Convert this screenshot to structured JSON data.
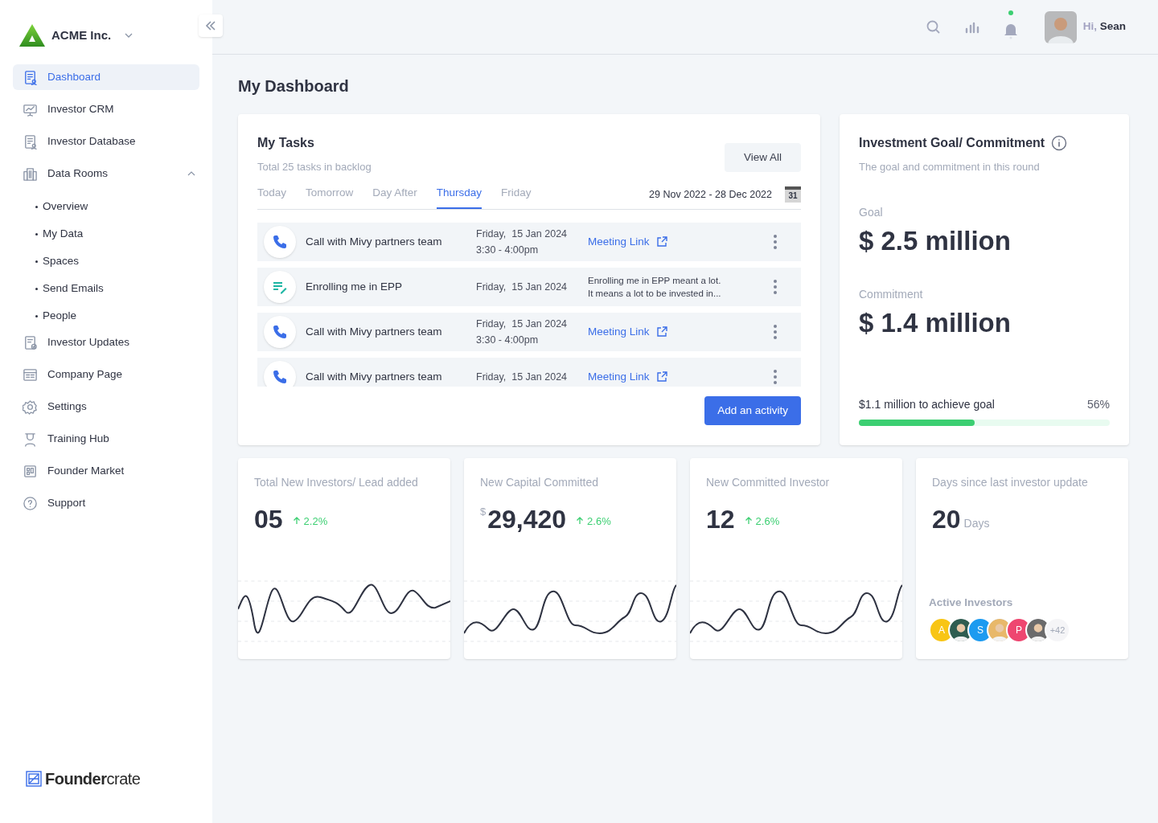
{
  "company": {
    "name": "ACME Inc."
  },
  "sidebar": {
    "items": [
      {
        "label": "Dashboard",
        "selected": true
      },
      {
        "label": "Investor CRM",
        "selected": false
      },
      {
        "label": "Investor Database",
        "selected": false
      },
      {
        "label": "Data Rooms",
        "selected": false,
        "expanded": true,
        "children": [
          {
            "label": "Overview",
            "selected": false
          },
          {
            "label": "My Data",
            "selected": false
          },
          {
            "label": "Spaces",
            "selected": false
          },
          {
            "label": "Send Emails",
            "selected": false
          },
          {
            "label": "People",
            "selected": false
          }
        ]
      },
      {
        "label": "Investor Updates",
        "selected": false
      },
      {
        "label": "Company Page",
        "selected": false
      },
      {
        "label": "Settings",
        "selected": false
      },
      {
        "label": "Training Hub",
        "selected": false
      },
      {
        "label": "Founder Market",
        "selected": false
      },
      {
        "label": "Support",
        "selected": false
      }
    ],
    "brand": "**Founder**crate"
  },
  "header": {
    "unread_notifications": true,
    "greeting": "Hi,",
    "user": "Sean"
  },
  "page_title": "My Dashboard",
  "tasks": {
    "title": "My Tasks",
    "subtitle": "Total 25 tasks in backlog",
    "view_all": "View All",
    "tabs": [
      {
        "label": "Today",
        "selected": false
      },
      {
        "label": "Tomorrow",
        "selected": false
      },
      {
        "label": "Day After",
        "selected": false
      },
      {
        "label": "Thursday",
        "selected": true
      },
      {
        "label": "Friday",
        "selected": false
      }
    ],
    "date_range": "29 Nov 2022 - 28 Dec 2022",
    "calendar_day": "31",
    "rows": [
      {
        "kind": "call",
        "title": "Call with Mivy partners team",
        "date": "Friday,  15 Jan 2024",
        "time": "3:30 - 4:00pm",
        "link": "Meeting Link"
      },
      {
        "kind": "note",
        "title": "Enrolling me in EPP",
        "date": "Friday,  15 Jan 2024",
        "note": [
          "Enrolling me in EPP meant a lot.",
          "It means a lot to be invested in..."
        ]
      },
      {
        "kind": "call",
        "title": "Call with Mivy partners team",
        "date": "Friday,  15 Jan 2024",
        "time": "3:30 - 4:00pm",
        "link": "Meeting Link"
      },
      {
        "kind": "call",
        "title": "Call with Mivy partners team",
        "date": "Friday,  15 Jan 2024",
        "link": "Meeting Link"
      }
    ],
    "add_button": "Add an activity"
  },
  "goal": {
    "title": "Investment Goal/ Commitment",
    "subtitle": "The goal and commitment in this round",
    "goal_label": "Goal",
    "goal_value": "$ 2.5 million",
    "commitment_label": "Commitment",
    "commitment_value": "$ 1.4 million",
    "progress_label": "$1.1 million to achieve goal",
    "percent": "56%",
    "level": 0.46
  },
  "stats": [
    {
      "kind": "trend",
      "title": "Total New Investors/ Lead added",
      "value": "05",
      "change": "2.2%"
    },
    {
      "kind": "trend",
      "title": "New Capital Committed",
      "prefix": "$",
      "value": "29,420",
      "change": "2.6%"
    },
    {
      "kind": "trend",
      "title": "New Committed Investor",
      "value": "12",
      "change": "2.6%"
    },
    {
      "kind": "days",
      "title": "Days since last investor update",
      "value": "20",
      "unit": "Days",
      "investors_label": "Active Investors",
      "avatars": [
        {
          "kind": "letter",
          "text": "A",
          "color": "#f8c515"
        },
        {
          "kind": "photo",
          "color": "#2f5d50"
        },
        {
          "kind": "letter",
          "text": "S",
          "color": "#1d9bf0"
        },
        {
          "kind": "photo",
          "color": "#e8b86a"
        },
        {
          "kind": "letter",
          "text": "P",
          "color": "#ee4670"
        },
        {
          "kind": "photo",
          "color": "#6b6b6b"
        }
      ],
      "more": "+42"
    }
  ]
}
